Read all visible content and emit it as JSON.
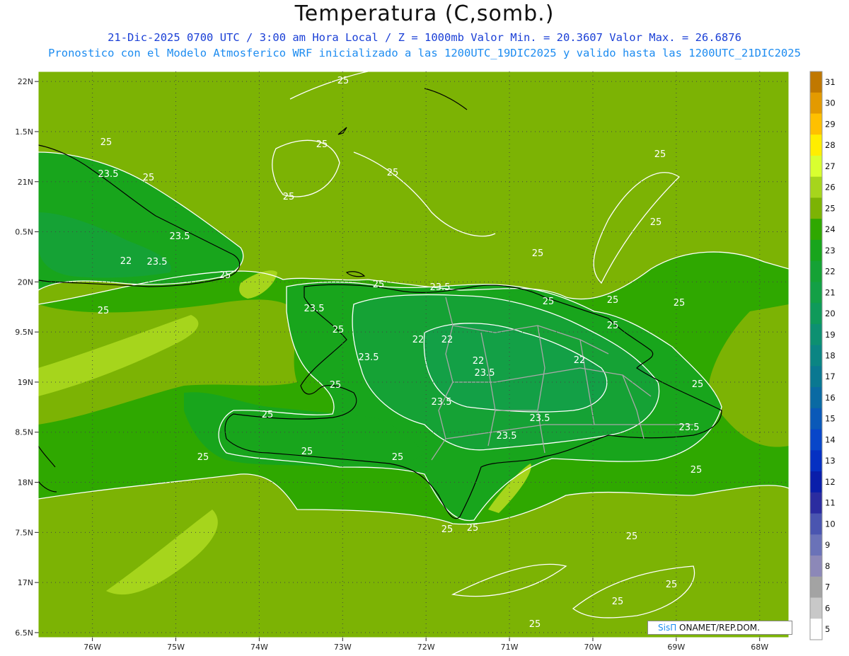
{
  "header": {
    "title": "Temperatura (C,somb.)",
    "line1": "21-Dic-2025  0700 UTC / 3:00 am Hora Local / Z = 1000mb   Valor Min. = 20.3607  Valor Max. = 26.6876",
    "line2": "Pronostico con el Modelo Atmosferico WRF inicializado a las 1200UTC_19DIC2025 y valido hasta las  1200UTC_21DIC2025"
  },
  "axes": {
    "lat_labels": [
      "22N",
      "1.5N",
      "21N",
      "0.5N",
      "20N",
      "9.5N",
      "19N",
      "8.5N",
      "18N",
      "7.5N",
      "17N",
      "6.5N"
    ],
    "lon_labels": [
      "76W",
      "75W",
      "74W",
      "73W",
      "72W",
      "71W",
      "70W",
      "69W",
      "68W"
    ],
    "lat_range": [
      16.45,
      22.1
    ],
    "lon_range": [
      -76.65,
      -67.65
    ]
  },
  "colorbar": {
    "levels": [
      "31",
      "30",
      "29",
      "28",
      "27",
      "26",
      "25",
      "24",
      "23",
      "22",
      "21",
      "20",
      "19",
      "18",
      "17",
      "16",
      "15",
      "14",
      "13",
      "12",
      "11",
      "10",
      "9",
      "8",
      "7",
      "6",
      "5"
    ],
    "colors": [
      "#c07800",
      "#e39a00",
      "#ffc000",
      "#ffee00",
      "#d9ff30",
      "#a6d51c",
      "#7cb304",
      "#2fa800",
      "#18a51c",
      "#15a235",
      "#13a046",
      "#0f9a5a",
      "#0d9071",
      "#0b8583",
      "#0a7891",
      "#0a6aa3",
      "#0a59b8",
      "#0846c9",
      "#0530c2",
      "#0a1eaa",
      "#2b2ca0",
      "#4a55b0",
      "#6a72b8",
      "#8c88b8",
      "#a3a3a3",
      "#c8c8c8",
      "#ffffff"
    ]
  },
  "contour_labels": [
    "25",
    "25",
    "25",
    "25",
    "25",
    "25",
    "25",
    "25",
    "25",
    "25",
    "25",
    "25",
    "25",
    "25",
    "25",
    "25",
    "25",
    "25",
    "25",
    "25",
    "25",
    "25",
    "25",
    "23.5",
    "23.5",
    "23.5",
    "23.5",
    "23.5",
    "23.5",
    "23.5",
    "23.5",
    "23.5",
    "23.5",
    "23.5",
    "22",
    "22",
    "22",
    "22",
    "22"
  ],
  "credit": {
    "brand": "SisΠ",
    "text": " ONAMET/REP.DOM."
  }
}
